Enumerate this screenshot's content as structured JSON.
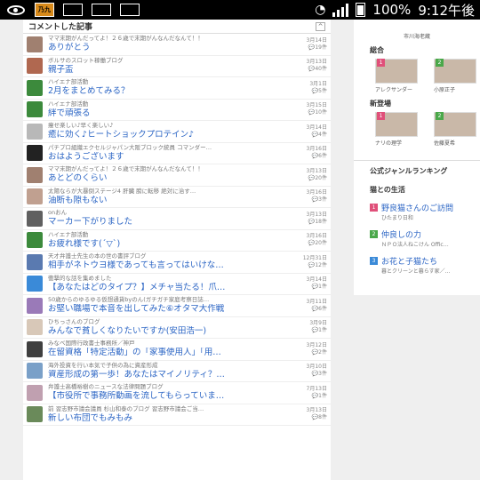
{
  "status_bar": {
    "battery": "100%",
    "time": "9:12午後",
    "badge": "乃九"
  },
  "main": {
    "title": "コメントした記事",
    "collapse_glyph": "^",
    "rows": [
      {
        "source": "ママ末期がんだってよ！２６歳で末期がんなんだなんて！！",
        "title": "ありがとう",
        "date": "3月14日",
        "count": "19件",
        "color": "#a08070"
      },
      {
        "source": "ボルサのスロット稼働ブログ",
        "title": "親子盃",
        "date": "3月13日",
        "count": "40件",
        "color": "#b06850"
      },
      {
        "source": "ハイエナ部活動",
        "title": "2月をまとめてみる？",
        "date": "3月1日",
        "count": "5件",
        "color": "#3c8a3c"
      },
      {
        "source": "ハイエナ部活動",
        "title": "絆で頑張る",
        "date": "3月15日",
        "count": "10件",
        "color": "#3c8a3c"
      },
      {
        "source": "痩せ楽しい♪早く楽しい♪",
        "title": "癒に効く♪ヒートショックプロテイン♪",
        "date": "3月14日",
        "count": "4件",
        "color": "#b8b8b8"
      },
      {
        "source": "パチプロ組織エクセルジャパン大阪ブロック統員 コマンダー…",
        "title": "おはようございます",
        "date": "3月16日",
        "count": "6件",
        "color": "#222222"
      },
      {
        "source": "ママ末期がんだってよ！２６歳で末期がんなんだなんて！！",
        "title": "あとどのくらい",
        "date": "3月13日",
        "count": "20件",
        "color": "#a08070"
      },
      {
        "source": "太陽ならが大暴倒ステージ4 肝臓 膀に転移 絶対に治す…",
        "title": "油断も隙もない",
        "date": "3月16日",
        "count": "3件",
        "color": "#c0a090"
      },
      {
        "source": "onおん",
        "title": "マーカー下がりました",
        "date": "3月13日",
        "count": "18件",
        "color": "#606060"
      },
      {
        "source": "ハイエナ部活動",
        "title": "お疲れ様です(´▽`)",
        "date": "3月16日",
        "count": "20件",
        "color": "#3c8a3c"
      },
      {
        "source": "天才弁護士先生の本の世の書評ブログ",
        "title": "相手がネトウヨ様であっても言ってはいけな…",
        "date": "12月31日",
        "count": "12件",
        "color": "#5a7ab0"
      },
      {
        "source": "衝撃的な話を集めました",
        "title": "【あなたはどのタイプ？】メチャ当たる！爪…",
        "date": "3月14日",
        "count": "1件",
        "color": "#3a8ad8"
      },
      {
        "source": "50歳からのゆるゆる仮想通貨byのん(ガチガチ家庭考察日誌…",
        "title": "お堅い職場で本音を出してみた⑥オタマ大作戦",
        "date": "3月11日",
        "count": "6件",
        "color": "#9a7ab8"
      },
      {
        "source": "ひちっさんのブログ",
        "title": "みんなで貧しくなりたいですか(安田浩一)",
        "date": "3月9日",
        "count": "1件",
        "color": "#d8c8b8"
      },
      {
        "source": "みなべ国際行政書士事務所／神戸",
        "title": "在留資格「特定活動」の「家事使用人」「用…",
        "date": "3月12日",
        "count": "2件",
        "color": "#404040"
      },
      {
        "source": "海外投資を行い本気で子供の為に資産形成",
        "title": "資産形成の第一歩！あなたはマイノリティ？…",
        "date": "3月10日",
        "count": "3件",
        "color": "#7aa0c8"
      },
      {
        "source": "弁護士高橋裕樹のニュースな法律問題ブログ",
        "title": "【市役所で事務所動画を流してもらっていま…",
        "date": "7月13日",
        "count": "1件",
        "color": "#c0a0b0"
      },
      {
        "source": "前 習志野市議会議員 杉山和泰のブログ 習志野市議会ご当…",
        "title": "新しい布団でもみもみ",
        "date": "3月13日",
        "count": "8件",
        "color": "#6a8a5a"
      }
    ]
  },
  "side": {
    "top_name": "市川海老蔵",
    "sections": [
      {
        "label": "総合",
        "users": [
          {
            "rank": "1",
            "name": "アレクサンダー",
            "color": "#e0507a"
          },
          {
            "rank": "2",
            "name": "小原正子",
            "color": "#4aa84a"
          }
        ]
      },
      {
        "label": "新登場",
        "users": [
          {
            "rank": "1",
            "name": "ナリの理学",
            "color": "#e0507a"
          },
          {
            "rank": "2",
            "name": "佐藤夏希",
            "color": "#4aa84a"
          }
        ]
      }
    ]
  },
  "genre": {
    "title": "公式ジャンルランキング",
    "sub": "猫との生活",
    "items": [
      {
        "rank": "1",
        "title": "野良猫さんのご訪問",
        "desc": "ひたまり日和",
        "color": "#e0507a"
      },
      {
        "rank": "2",
        "title": "仲良しの力",
        "desc": "ＮＰＯ法人ねこけん Offic…",
        "color": "#4aa84a"
      },
      {
        "rank": "3",
        "title": "お花と子猫たち",
        "desc": "暮とクリーンと暮らす家／…",
        "color": "#3a8ad8"
      }
    ]
  }
}
